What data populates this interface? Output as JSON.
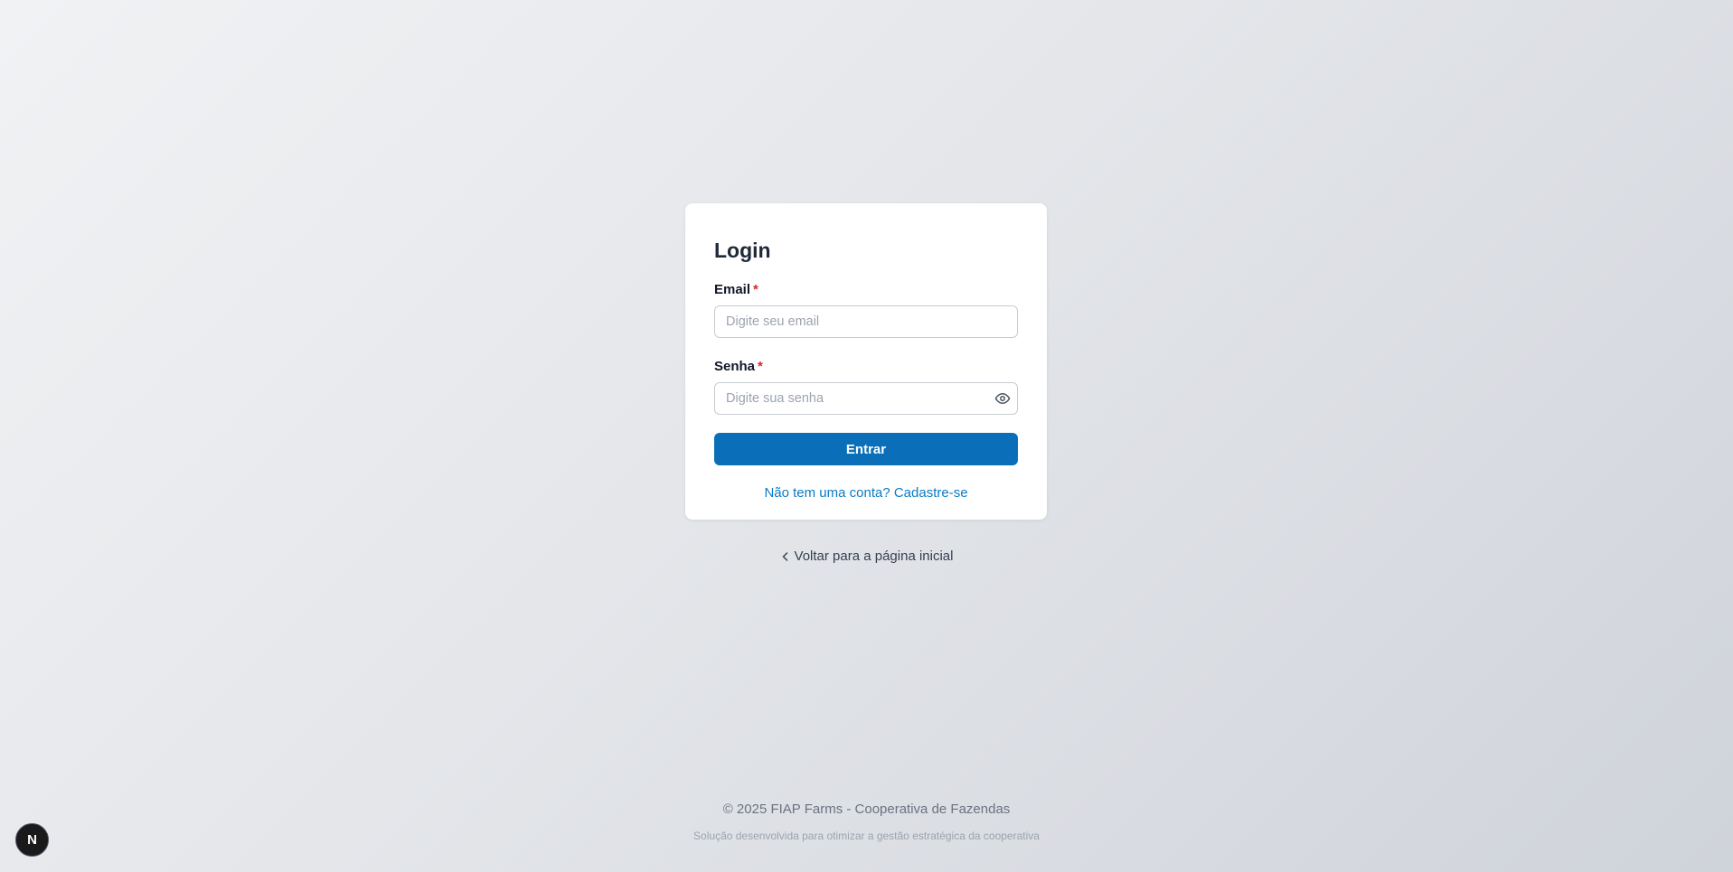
{
  "login": {
    "title": "Login",
    "email_label": "Email",
    "email_required": "*",
    "email_placeholder": "Digite seu email",
    "email_value": "",
    "password_label": "Senha",
    "password_required": "*",
    "password_placeholder": "Digite sua senha",
    "password_value": "",
    "submit_label": "Entrar",
    "signup_link": "Não tem uma conta? Cadastre-se"
  },
  "back_link": "Voltar para a página inicial",
  "footer": {
    "copyright": "© 2025 FIAP Farms - Cooperativa de Fazendas",
    "tagline": "Solução desenvolvida para otimizar a gestão estratégica da cooperativa"
  },
  "badge": {
    "letter": "N"
  },
  "colors": {
    "primary": "#0a6fb8",
    "link": "#0a7bc4",
    "required": "#dc2626"
  },
  "icons": {
    "password_toggle": "eye-icon",
    "back": "chevron-left-icon"
  }
}
